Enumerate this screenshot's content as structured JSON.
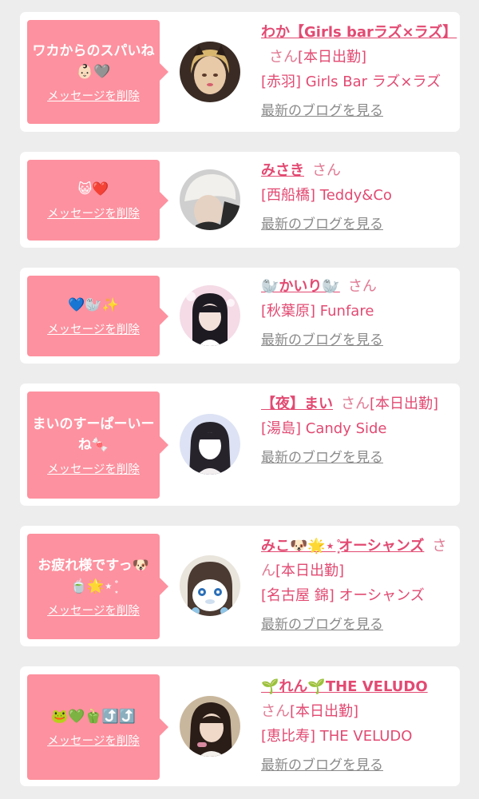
{
  "page": {
    "colors": {
      "background": "#ededed",
      "card": "#ffffff",
      "bubble": "#fd919f",
      "accent": "#e24a72",
      "muted": "#8a8a8a"
    }
  },
  "messages": [
    {
      "message": "ワカからのスパいね👶🏻🩶",
      "delete_label": "メッセージを削除",
      "name": "わか【Girls barラズ×ラズ】",
      "honorific": "さん",
      "status": "[本日出勤]",
      "shop": "[赤羽] Girls Bar ラズ×ラズ",
      "blog_label": "最新のブログを見る",
      "avatar_icon": "profile-photo"
    },
    {
      "message": "😺❤️",
      "delete_label": "メッセージを削除",
      "name": "みさき",
      "honorific": "さん",
      "status": "",
      "shop": "[西船橋] Teddy&Co",
      "blog_label": "最新のブログを見る",
      "avatar_icon": "profile-photo"
    },
    {
      "message": "💙🦭✨",
      "delete_label": "メッセージを削除",
      "name": "🦭かいり🦭",
      "honorific": "さん",
      "status": "",
      "shop": "[秋葉原] Funfare",
      "blog_label": "最新のブログを見る",
      "avatar_icon": "profile-photo"
    },
    {
      "message": "まいのすーぱーいーね🍬",
      "delete_label": "メッセージを削除",
      "name": "【夜】まい",
      "honorific": "さん",
      "status": "[本日出勤]",
      "shop": "[湯島] Candy Side",
      "blog_label": "最新のブログを見る",
      "avatar_icon": "profile-photo"
    },
    {
      "message": "お疲れ様ですっ🐶🍵🌟⋆ ͙̊",
      "delete_label": "メッセージを削除",
      "name": "みこ🐶🌟⋆ ͙̊オーシャンズ",
      "honorific": "さん",
      "status": "[本日出勤]",
      "shop": "[名古屋 錦] オーシャンズ",
      "blog_label": "最新のブログを見る",
      "avatar_icon": "profile-photo"
    },
    {
      "message": "🐸💚🫑⤴️⤴️",
      "delete_label": "メッセージを削除",
      "name": "🌱れん🌱THE VELUDO",
      "honorific": "さん",
      "status": "[本日出勤]",
      "shop": "[恵比寿] THE VELUDO",
      "blog_label": "最新のブログを見る",
      "avatar_icon": "profile-photo"
    }
  ]
}
